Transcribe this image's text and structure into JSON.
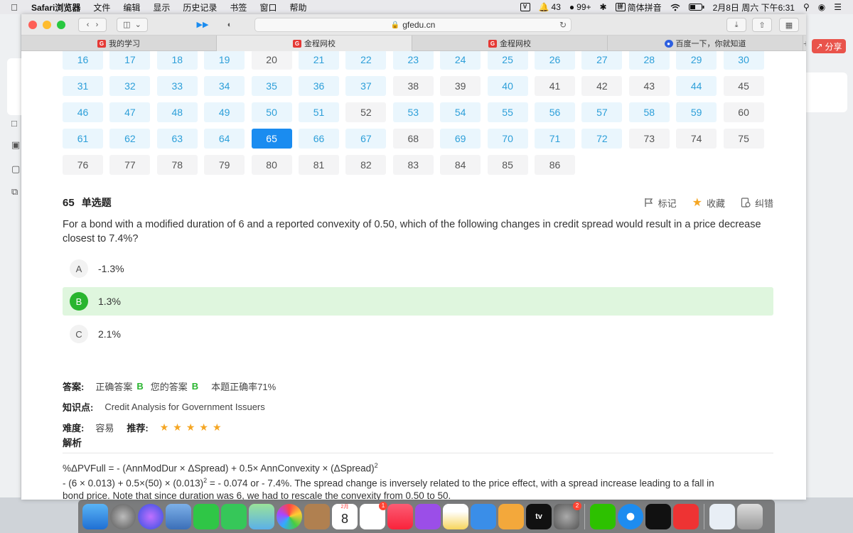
{
  "menubar": {
    "app_name": "Safari浏览器",
    "items": [
      "文件",
      "编辑",
      "显示",
      "历史记录",
      "书签",
      "窗口",
      "帮助"
    ],
    "status": {
      "notif_count": "43",
      "wechat_count": "99+",
      "ime": "简体拼音",
      "datetime": "2月8日 周六 下午6:31"
    }
  },
  "desktop": {
    "share_label": "分享"
  },
  "safari": {
    "url": "gfedu.cn",
    "tabs": [
      "我的学习",
      "金程网校",
      "金程网校",
      "百度一下，你就知道"
    ]
  },
  "question_grid": {
    "rows": [
      [
        {
          "n": "16",
          "s": "ans"
        },
        {
          "n": "17",
          "s": "ans"
        },
        {
          "n": "18",
          "s": "ans"
        },
        {
          "n": "19",
          "s": "ans"
        },
        {
          "n": "20",
          "s": "un"
        },
        {
          "n": "21",
          "s": "ans"
        },
        {
          "n": "22",
          "s": "ans"
        },
        {
          "n": "23",
          "s": "ans"
        },
        {
          "n": "24",
          "s": "ans"
        },
        {
          "n": "25",
          "s": "ans"
        },
        {
          "n": "26",
          "s": "ans"
        },
        {
          "n": "27",
          "s": "ans"
        },
        {
          "n": "28",
          "s": "ans"
        },
        {
          "n": "29",
          "s": "ans"
        },
        {
          "n": "30",
          "s": "ans"
        }
      ],
      [
        {
          "n": "31",
          "s": "ans"
        },
        {
          "n": "32",
          "s": "ans"
        },
        {
          "n": "33",
          "s": "ans"
        },
        {
          "n": "34",
          "s": "ans"
        },
        {
          "n": "35",
          "s": "ans"
        },
        {
          "n": "36",
          "s": "ans"
        },
        {
          "n": "37",
          "s": "ans"
        },
        {
          "n": "38",
          "s": "un"
        },
        {
          "n": "39",
          "s": "un"
        },
        {
          "n": "40",
          "s": "ans"
        },
        {
          "n": "41",
          "s": "un"
        },
        {
          "n": "42",
          "s": "un"
        },
        {
          "n": "43",
          "s": "un"
        },
        {
          "n": "44",
          "s": "ans"
        },
        {
          "n": "45",
          "s": "un"
        }
      ],
      [
        {
          "n": "46",
          "s": "ans"
        },
        {
          "n": "47",
          "s": "ans"
        },
        {
          "n": "48",
          "s": "ans"
        },
        {
          "n": "49",
          "s": "ans"
        },
        {
          "n": "50",
          "s": "ans"
        },
        {
          "n": "51",
          "s": "ans"
        },
        {
          "n": "52",
          "s": "un"
        },
        {
          "n": "53",
          "s": "ans"
        },
        {
          "n": "54",
          "s": "ans"
        },
        {
          "n": "55",
          "s": "ans"
        },
        {
          "n": "56",
          "s": "ans"
        },
        {
          "n": "57",
          "s": "ans"
        },
        {
          "n": "58",
          "s": "ans"
        },
        {
          "n": "59",
          "s": "ans"
        },
        {
          "n": "60",
          "s": "un"
        }
      ],
      [
        {
          "n": "61",
          "s": "ans"
        },
        {
          "n": "62",
          "s": "ans"
        },
        {
          "n": "63",
          "s": "ans"
        },
        {
          "n": "64",
          "s": "ans"
        },
        {
          "n": "65",
          "s": "cur"
        },
        {
          "n": "66",
          "s": "ans"
        },
        {
          "n": "67",
          "s": "ans"
        },
        {
          "n": "68",
          "s": "un"
        },
        {
          "n": "69",
          "s": "ans"
        },
        {
          "n": "70",
          "s": "ans"
        },
        {
          "n": "71",
          "s": "ans"
        },
        {
          "n": "72",
          "s": "ans"
        },
        {
          "n": "73",
          "s": "un"
        },
        {
          "n": "74",
          "s": "un"
        },
        {
          "n": "75",
          "s": "un"
        }
      ],
      [
        {
          "n": "76",
          "s": "un"
        },
        {
          "n": "77",
          "s": "un"
        },
        {
          "n": "78",
          "s": "un"
        },
        {
          "n": "79",
          "s": "un"
        },
        {
          "n": "80",
          "s": "un"
        },
        {
          "n": "81",
          "s": "un"
        },
        {
          "n": "82",
          "s": "un"
        },
        {
          "n": "83",
          "s": "un"
        },
        {
          "n": "84",
          "s": "un"
        },
        {
          "n": "85",
          "s": "un"
        },
        {
          "n": "86",
          "s": "un"
        }
      ]
    ]
  },
  "question": {
    "number": "65",
    "type": "单选题",
    "tools": {
      "mark": "标记",
      "favorite": "收藏",
      "correct": "纠错"
    },
    "text": "For a bond with a modified duration of 6 and a reported convexity of 0.50, which of the following changes in credit spread would result in a price decrease closest to 7.4%?",
    "options": [
      {
        "letter": "A",
        "text": "-1.3%"
      },
      {
        "letter": "B",
        "text": "1.3%"
      },
      {
        "letter": "C",
        "text": "2.1%"
      }
    ]
  },
  "answer": {
    "label": "答案:",
    "correct_label": "正确答案",
    "correct_value": "B",
    "your_label": "您的答案",
    "your_value": "B",
    "rate_text": "本题正确率71%"
  },
  "knowledge": {
    "label": "知识点:",
    "value": "Credit Analysis for Government Issuers"
  },
  "difficulty": {
    "label": "难度:",
    "value": "容易",
    "rec_label": "推荐:",
    "stars": 5
  },
  "explanation": {
    "title": "解析",
    "line1": "%ΔPVFull = - (AnnModDur × ΔSpread) + 0.5× AnnConvexity × (ΔSpread)",
    "line2a": "- (6 × 0.013) + 0.5×(50) × (0.013)",
    "line2b": " = - 0.074 or - 7.4%. The spread change is inversely related to the price effect, with a spread increase leading to a fall in",
    "line3": "bond price. Note that since duration was 6, we had to rescale the convexity from 0.50 to 50."
  },
  "dock": {
    "calendar_day": "8",
    "calendar_month": "2月",
    "tv_label": "tv",
    "badges": {
      "reminders": "1",
      "sysprefs": "2"
    }
  },
  "colors": {
    "accent": "#1a8cf0",
    "answered_text": "#2d9fd9",
    "correct_green": "#29b52f",
    "star": "#f5a623"
  }
}
